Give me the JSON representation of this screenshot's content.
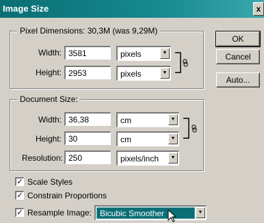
{
  "window": {
    "title": "Image Size",
    "close_glyph": "x"
  },
  "pixel_dimensions": {
    "legend": "Pixel Dimensions:  30,3M (was 9,29M)",
    "width_label": "Width:",
    "width_value": "3581",
    "width_unit": "pixels",
    "height_label": "Height:",
    "height_value": "2953",
    "height_unit": "pixels"
  },
  "document_size": {
    "legend": "Document Size:",
    "width_label": "Width:",
    "width_value": "36,38",
    "width_unit": "cm",
    "height_label": "Height:",
    "height_value": "30",
    "height_unit": "cm",
    "resolution_label": "Resolution:",
    "resolution_value": "250",
    "resolution_unit": "pixels/inch"
  },
  "buttons": {
    "ok": "OK",
    "cancel": "Cancel",
    "auto": "Auto..."
  },
  "options": {
    "scale_styles": {
      "label": "Scale Styles",
      "checked": true
    },
    "constrain_proportions": {
      "label": "Constrain Proportions",
      "checked": true
    },
    "resample_image": {
      "label": "Resample Image:",
      "checked": true,
      "method": "Bicubic Smoother"
    }
  },
  "colors": {
    "titlebar": "#0a6e74",
    "face": "#d4d0c8",
    "selection": "#0a6e74"
  },
  "icons": {
    "checkmark": "✓",
    "arrow": "▼",
    "link": "chain-link-icon"
  }
}
